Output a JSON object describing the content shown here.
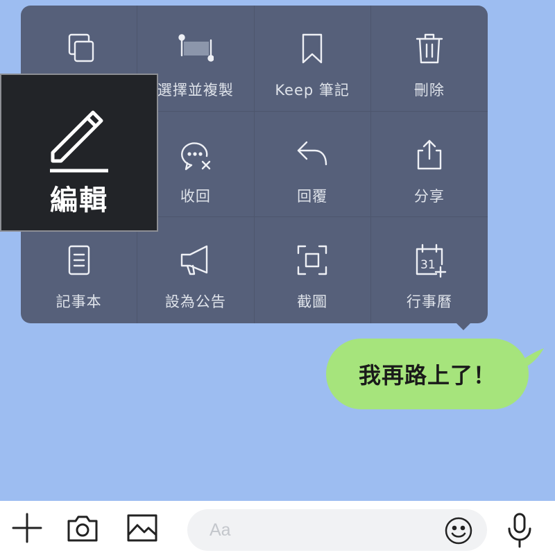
{
  "context_menu": {
    "items": [
      {
        "label": "",
        "icon": "copy-icon"
      },
      {
        "label": "選擇並複製",
        "icon": "select-text-icon"
      },
      {
        "label": "Keep 筆記",
        "icon": "bookmark-icon"
      },
      {
        "label": "刪除",
        "icon": "trash-icon"
      },
      {
        "label": "",
        "icon": "pencil-icon"
      },
      {
        "label": "收回",
        "icon": "unsend-chat-icon"
      },
      {
        "label": "回覆",
        "icon": "reply-arrow-icon"
      },
      {
        "label": "分享",
        "icon": "share-icon"
      },
      {
        "label": "記事本",
        "icon": "note-icon"
      },
      {
        "label": "設為公告",
        "icon": "megaphone-icon"
      },
      {
        "label": "截圖",
        "icon": "screenshot-icon"
      },
      {
        "label": "行事曆",
        "icon": "calendar-icon"
      }
    ],
    "calendar_day": "31"
  },
  "edit_highlight": {
    "label": "編輯",
    "icon": "pencil-icon"
  },
  "message": {
    "text": "我再路上了！",
    "color": "#a6e47c"
  },
  "input_bar": {
    "placeholder": "Aa"
  },
  "colors": {
    "background": "#9dbdf1",
    "menu": "#56607a",
    "bubble": "#a6e47c"
  }
}
